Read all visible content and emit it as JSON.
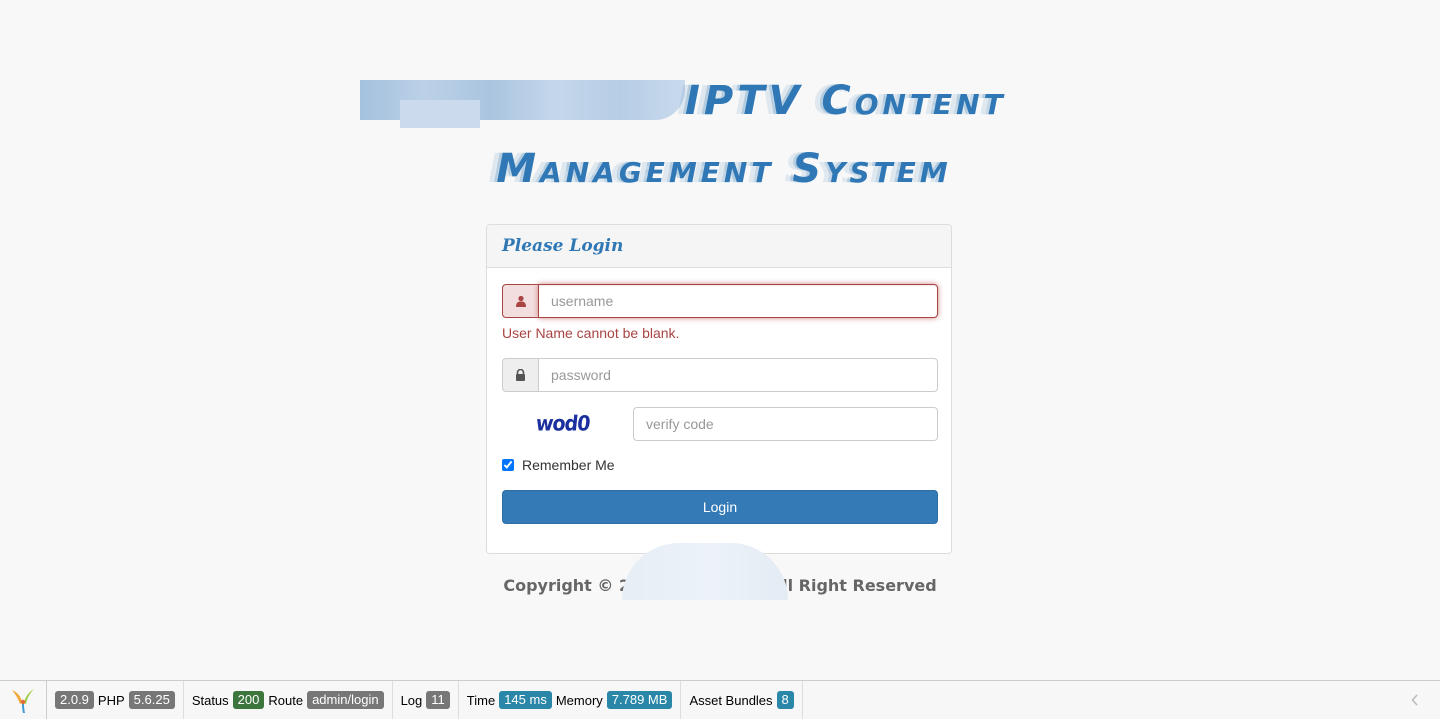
{
  "title": {
    "line1": "IPTV Content",
    "line2": "Management System"
  },
  "panel": {
    "heading": "Please Login"
  },
  "form": {
    "username_placeholder": "username",
    "username_error": "User Name cannot be blank.",
    "password_placeholder": "password",
    "captcha_text": "wod0",
    "verify_placeholder": "verify code",
    "remember_label": "Remember Me",
    "remember_checked": true,
    "login_label": "Login"
  },
  "footer": {
    "copyright_left": "Copyright © 2",
    "copyright_right": "ll Right Reserved"
  },
  "toolbar": {
    "yii_version": "2.0.9",
    "php_label": "PHP",
    "php_version": "5.6.25",
    "status_label": "Status",
    "status_code": "200",
    "route_label": "Route",
    "route_value": "admin/login",
    "log_label": "Log",
    "log_count": "11",
    "time_label": "Time",
    "time_value": "145 ms",
    "memory_label": "Memory",
    "memory_value": "7.789 MB",
    "assets_label": "Asset Bundles",
    "assets_count": "8",
    "collapse_icon": "chevron-left-icon"
  },
  "colors": {
    "primary": "#337ab7",
    "error": "#a94442",
    "title": "#2f78b5"
  }
}
